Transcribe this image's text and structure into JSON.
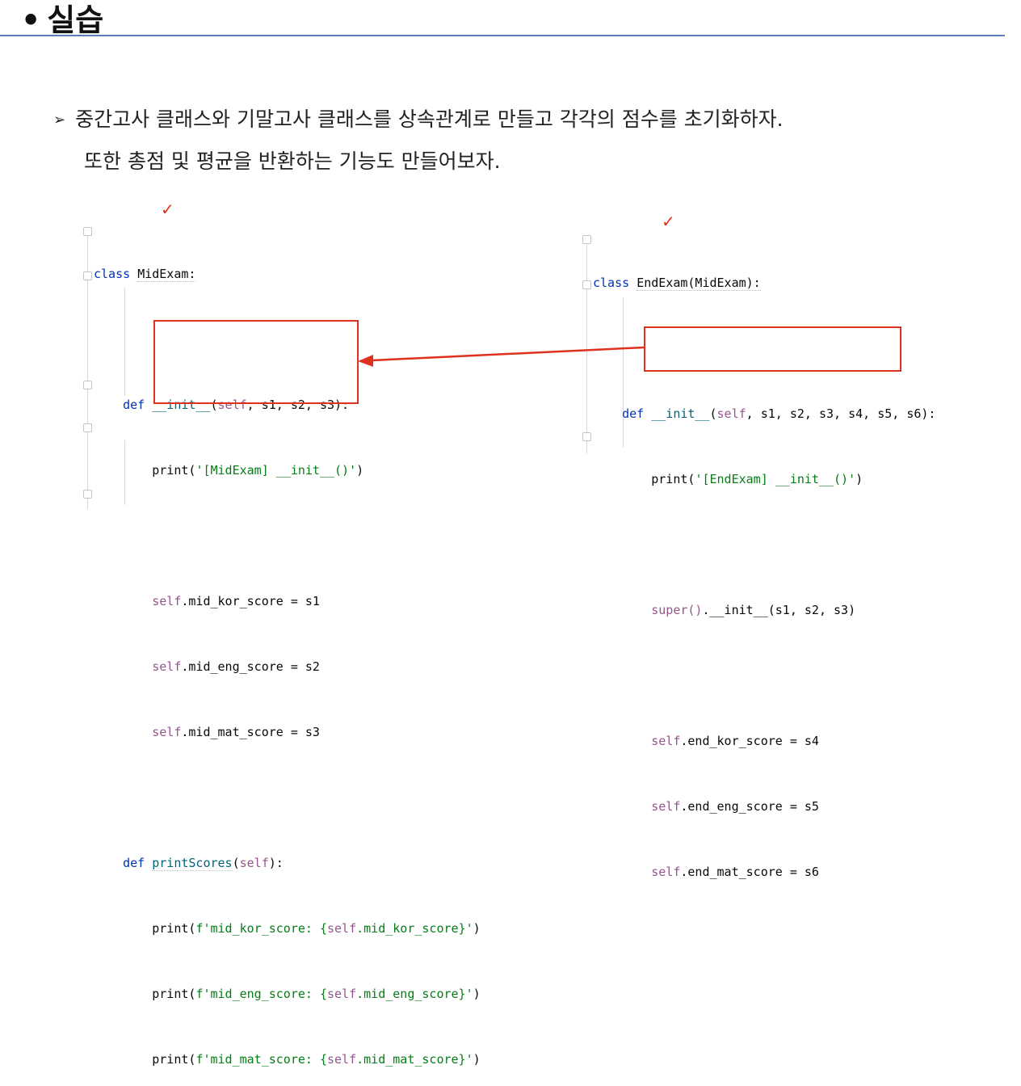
{
  "heading": {
    "bullet": "•",
    "text": "실습"
  },
  "description": {
    "bullet": "➢",
    "line1": "중간고사 클래스와 기말고사 클래스를 상속관계로 만들고 각각의 점수를 초기화하자.",
    "line2": "또한 총점 및 평균을 반환하는 기능도 만들어보자."
  },
  "mid_code": {
    "class_kw": "class",
    "class_name": "MidExam:",
    "init_def_kw": "def",
    "init_name": "__init__",
    "init_args_open": "(",
    "init_self": "self",
    "init_args_rest": ", s1, s2, s3):",
    "print_fn": "print(",
    "init_print_str": "'[MidExam] __init__()'",
    "close_paren": ")",
    "assign1_self": "self",
    "assign1_rest": ".mid_kor_score = s1",
    "assign2_self": "self",
    "assign2_rest": ".mid_eng_score = s2",
    "assign3_self": "self",
    "assign3_rest": ".mid_mat_score = s3",
    "ps_def_kw": "def",
    "ps_name": "printScores",
    "ps_args_open": "(",
    "ps_self": "self",
    "ps_args_close": "):",
    "p1_str_a": "f'mid_kor_score: {",
    "p1_self": "self",
    "p1_str_b": ".mid_kor_score}'",
    "p2_str_a": "f'mid_eng_score: {",
    "p2_self": "self",
    "p2_str_b": ".mid_eng_score}'",
    "p3_str_a": "f'mid_mat_score: {",
    "p3_self": "self",
    "p3_str_b": ".mid_mat_score}'"
  },
  "end_code": {
    "class_kw": "class",
    "class_name": "EndExam(MidExam):",
    "init_def_kw": "def",
    "init_name": "__init__",
    "init_args_open": "(",
    "init_self": "self",
    "init_args_rest": ", s1, s2, s3, s4, s5, s6):",
    "print_fn": "print(",
    "init_print_str": "'[EndExam] __init__()'",
    "close_paren": ")",
    "super_call": "super()",
    "super_rest": ".__init__(s1, s2, s3)",
    "assign1_self": "self",
    "assign1_rest": ".end_kor_score = s4",
    "assign2_self": "self",
    "assign2_rest": ".end_eng_score = s5",
    "assign3_self": "self",
    "assign3_rest": ".end_mat_score = s6"
  },
  "colors": {
    "annotation": "#e0301e",
    "rule": "#5b7fb4",
    "keyword": "#0033b3",
    "self": "#94558d",
    "string": "#067d17"
  }
}
